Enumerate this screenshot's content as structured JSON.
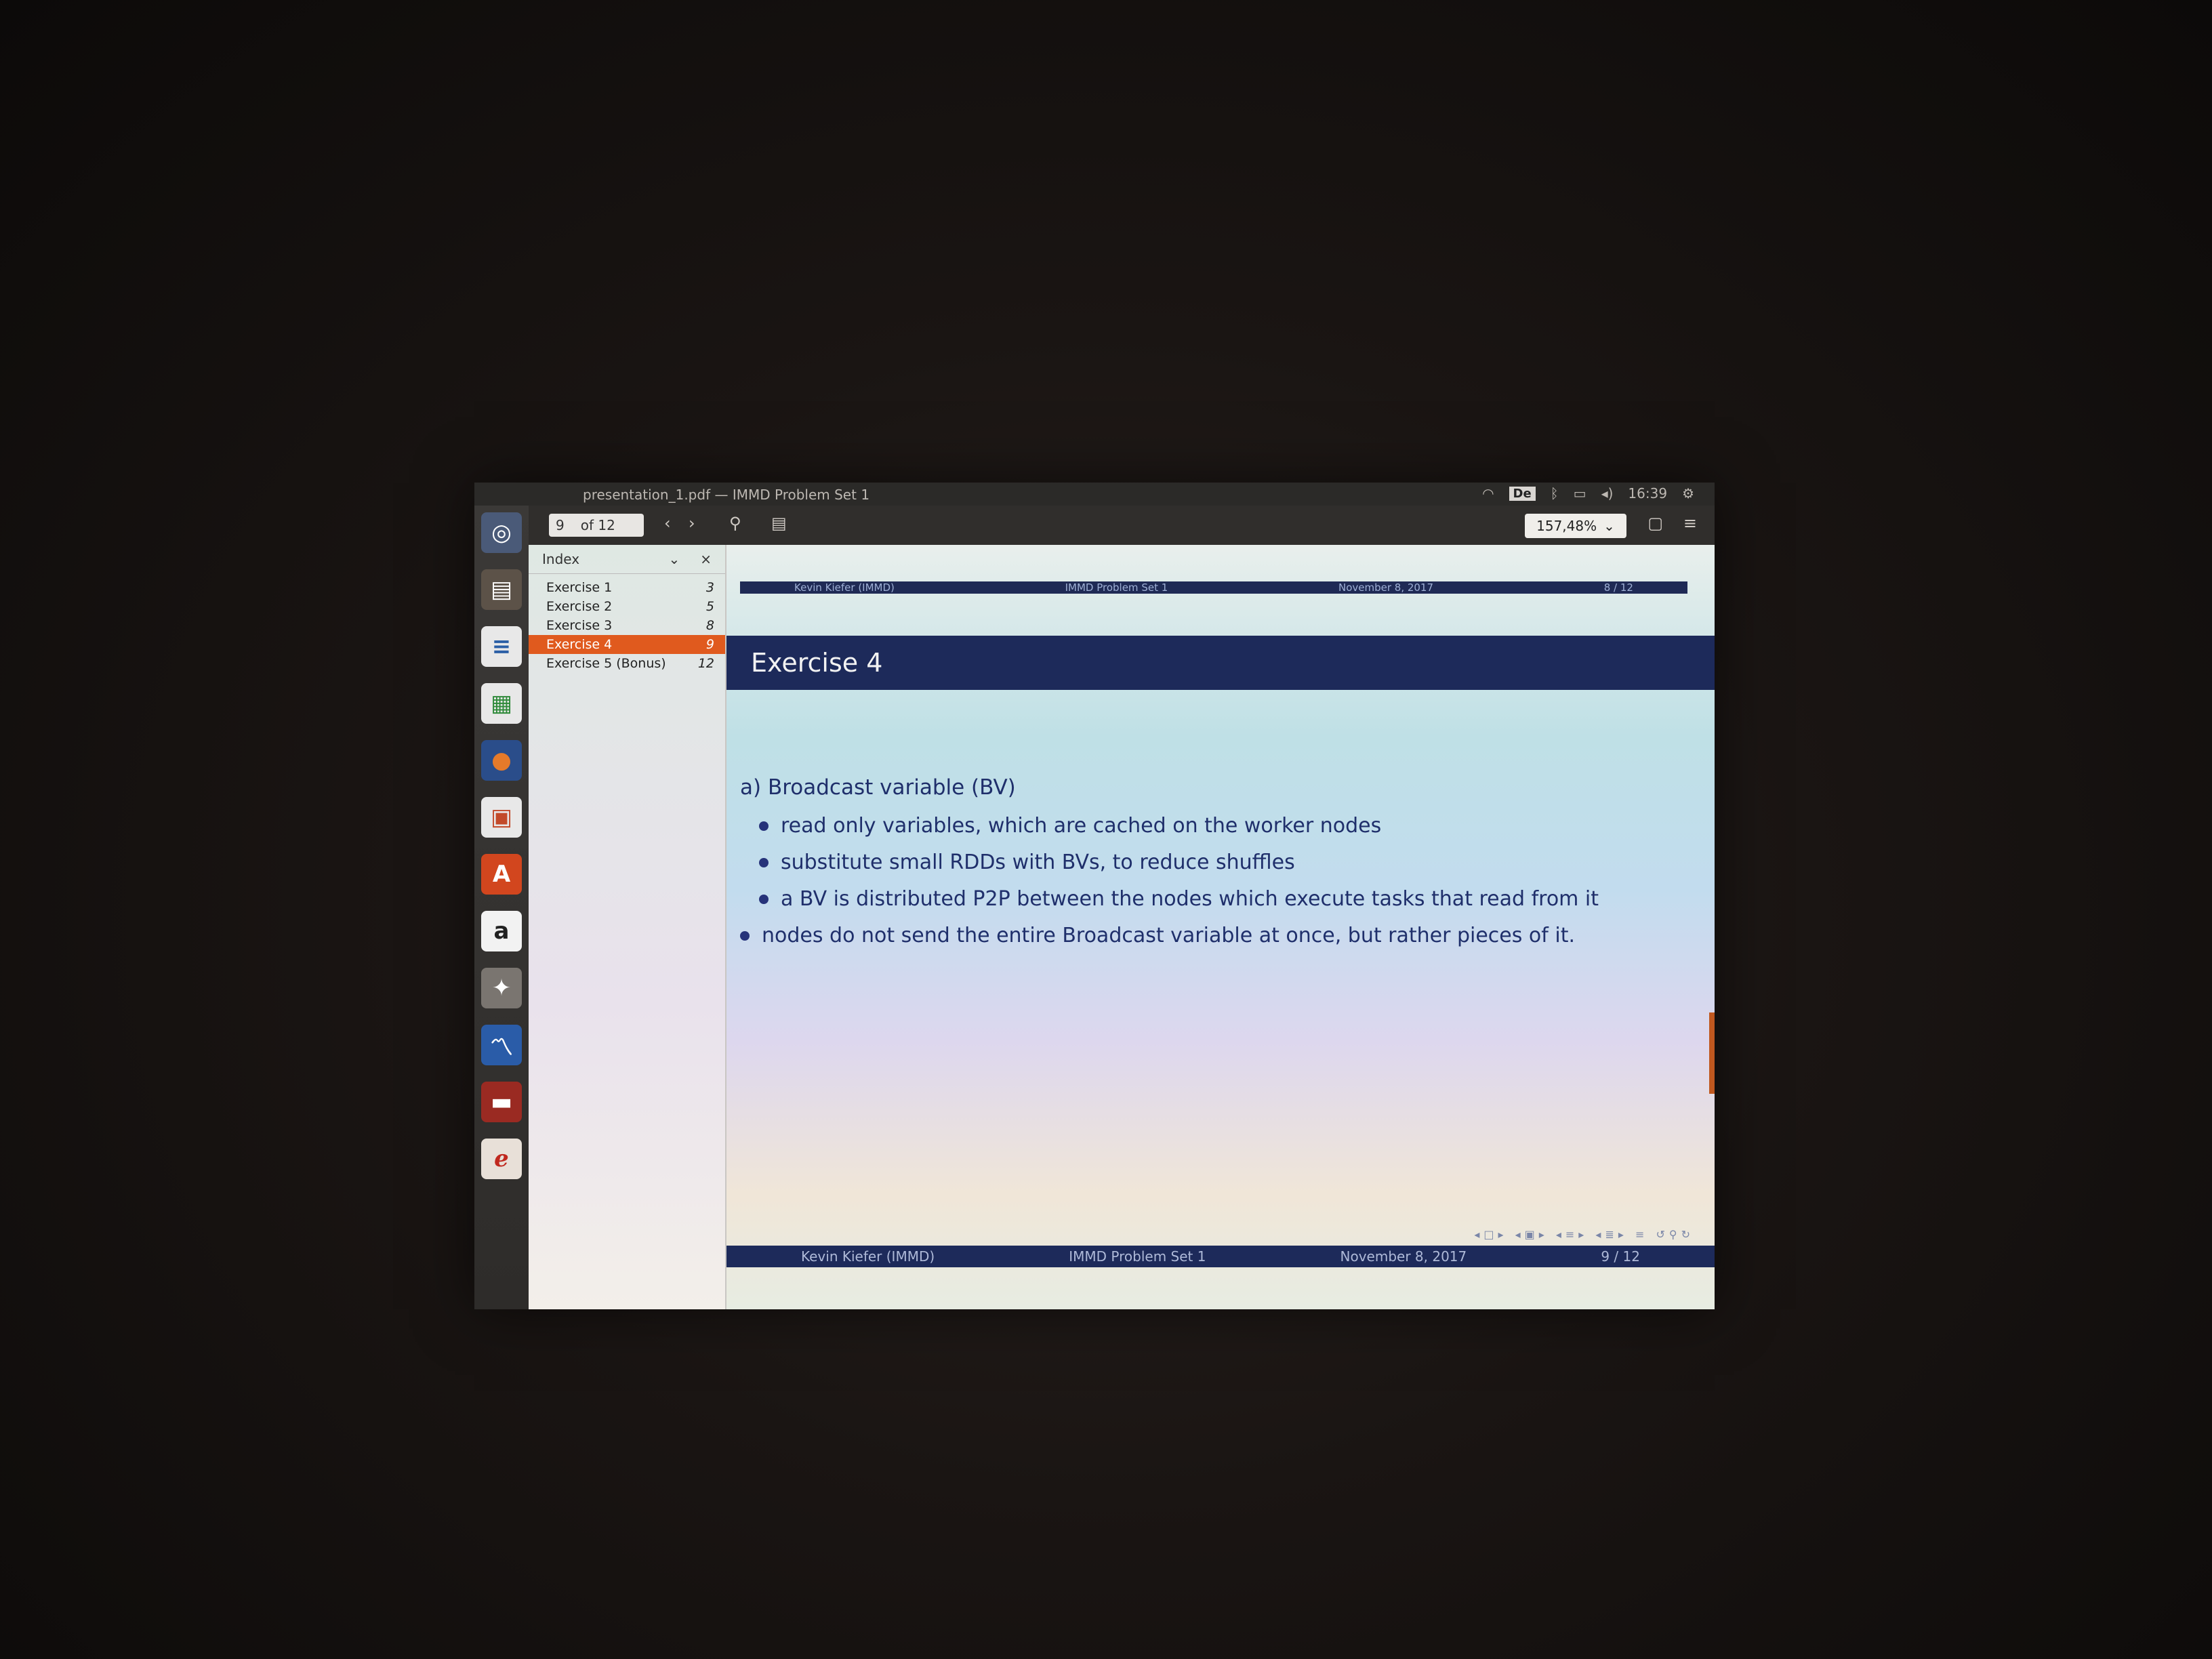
{
  "window": {
    "title": "presentation_1.pdf — IMMD Problem Set 1"
  },
  "tray": {
    "lang": "De",
    "time": "16:39"
  },
  "toolbar": {
    "page_current": "9",
    "page_total": "of 12",
    "zoom": "157,48%"
  },
  "sidebar": {
    "header": "Index",
    "close": "×",
    "items": [
      {
        "label": "Exercise 1",
        "page": "3"
      },
      {
        "label": "Exercise 2",
        "page": "5"
      },
      {
        "label": "Exercise 3",
        "page": "8"
      },
      {
        "label": "Exercise 4",
        "page": "9"
      },
      {
        "label": "Exercise 5 (Bonus)",
        "page": "12"
      }
    ]
  },
  "slide": {
    "prev_footer": {
      "author": "Kevin Kiefer (IMMD)",
      "title": "IMMD Problem Set 1",
      "date": "November 8, 2017",
      "page": "8 / 12"
    },
    "frame_title": "Exercise 4",
    "heading": "a) Broadcast variable (BV)",
    "bullets": [
      "read only variables, which are cached on the worker nodes",
      "substitute small RDDs with BVs, to reduce shuffles",
      "a BV is distributed P2P between the nodes which execute tasks that read from it",
      "nodes do not send the entire Broadcast variable at once, but rather pieces of it."
    ],
    "footer": {
      "author": "Kevin Kiefer (IMMD)",
      "title": "IMMD Problem Set 1",
      "date": "November 8, 2017",
      "page": "9 / 12"
    }
  }
}
